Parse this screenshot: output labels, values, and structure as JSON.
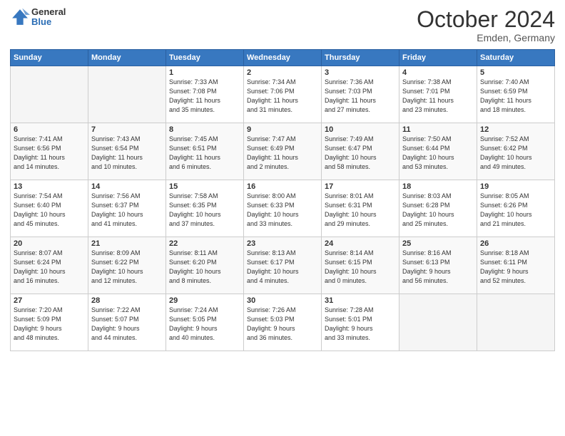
{
  "header": {
    "logo_general": "General",
    "logo_blue": "Blue",
    "month_title": "October 2024",
    "location": "Emden, Germany"
  },
  "weekdays": [
    "Sunday",
    "Monday",
    "Tuesday",
    "Wednesday",
    "Thursday",
    "Friday",
    "Saturday"
  ],
  "weeks": [
    [
      {
        "day": "",
        "info": ""
      },
      {
        "day": "",
        "info": ""
      },
      {
        "day": "1",
        "info": "Sunrise: 7:33 AM\nSunset: 7:08 PM\nDaylight: 11 hours\nand 35 minutes."
      },
      {
        "day": "2",
        "info": "Sunrise: 7:34 AM\nSunset: 7:06 PM\nDaylight: 11 hours\nand 31 minutes."
      },
      {
        "day": "3",
        "info": "Sunrise: 7:36 AM\nSunset: 7:03 PM\nDaylight: 11 hours\nand 27 minutes."
      },
      {
        "day": "4",
        "info": "Sunrise: 7:38 AM\nSunset: 7:01 PM\nDaylight: 11 hours\nand 23 minutes."
      },
      {
        "day": "5",
        "info": "Sunrise: 7:40 AM\nSunset: 6:59 PM\nDaylight: 11 hours\nand 18 minutes."
      }
    ],
    [
      {
        "day": "6",
        "info": "Sunrise: 7:41 AM\nSunset: 6:56 PM\nDaylight: 11 hours\nand 14 minutes."
      },
      {
        "day": "7",
        "info": "Sunrise: 7:43 AM\nSunset: 6:54 PM\nDaylight: 11 hours\nand 10 minutes."
      },
      {
        "day": "8",
        "info": "Sunrise: 7:45 AM\nSunset: 6:51 PM\nDaylight: 11 hours\nand 6 minutes."
      },
      {
        "day": "9",
        "info": "Sunrise: 7:47 AM\nSunset: 6:49 PM\nDaylight: 11 hours\nand 2 minutes."
      },
      {
        "day": "10",
        "info": "Sunrise: 7:49 AM\nSunset: 6:47 PM\nDaylight: 10 hours\nand 58 minutes."
      },
      {
        "day": "11",
        "info": "Sunrise: 7:50 AM\nSunset: 6:44 PM\nDaylight: 10 hours\nand 53 minutes."
      },
      {
        "day": "12",
        "info": "Sunrise: 7:52 AM\nSunset: 6:42 PM\nDaylight: 10 hours\nand 49 minutes."
      }
    ],
    [
      {
        "day": "13",
        "info": "Sunrise: 7:54 AM\nSunset: 6:40 PM\nDaylight: 10 hours\nand 45 minutes."
      },
      {
        "day": "14",
        "info": "Sunrise: 7:56 AM\nSunset: 6:37 PM\nDaylight: 10 hours\nand 41 minutes."
      },
      {
        "day": "15",
        "info": "Sunrise: 7:58 AM\nSunset: 6:35 PM\nDaylight: 10 hours\nand 37 minutes."
      },
      {
        "day": "16",
        "info": "Sunrise: 8:00 AM\nSunset: 6:33 PM\nDaylight: 10 hours\nand 33 minutes."
      },
      {
        "day": "17",
        "info": "Sunrise: 8:01 AM\nSunset: 6:31 PM\nDaylight: 10 hours\nand 29 minutes."
      },
      {
        "day": "18",
        "info": "Sunrise: 8:03 AM\nSunset: 6:28 PM\nDaylight: 10 hours\nand 25 minutes."
      },
      {
        "day": "19",
        "info": "Sunrise: 8:05 AM\nSunset: 6:26 PM\nDaylight: 10 hours\nand 21 minutes."
      }
    ],
    [
      {
        "day": "20",
        "info": "Sunrise: 8:07 AM\nSunset: 6:24 PM\nDaylight: 10 hours\nand 16 minutes."
      },
      {
        "day": "21",
        "info": "Sunrise: 8:09 AM\nSunset: 6:22 PM\nDaylight: 10 hours\nand 12 minutes."
      },
      {
        "day": "22",
        "info": "Sunrise: 8:11 AM\nSunset: 6:20 PM\nDaylight: 10 hours\nand 8 minutes."
      },
      {
        "day": "23",
        "info": "Sunrise: 8:13 AM\nSunset: 6:17 PM\nDaylight: 10 hours\nand 4 minutes."
      },
      {
        "day": "24",
        "info": "Sunrise: 8:14 AM\nSunset: 6:15 PM\nDaylight: 10 hours\nand 0 minutes."
      },
      {
        "day": "25",
        "info": "Sunrise: 8:16 AM\nSunset: 6:13 PM\nDaylight: 9 hours\nand 56 minutes."
      },
      {
        "day": "26",
        "info": "Sunrise: 8:18 AM\nSunset: 6:11 PM\nDaylight: 9 hours\nand 52 minutes."
      }
    ],
    [
      {
        "day": "27",
        "info": "Sunrise: 7:20 AM\nSunset: 5:09 PM\nDaylight: 9 hours\nand 48 minutes."
      },
      {
        "day": "28",
        "info": "Sunrise: 7:22 AM\nSunset: 5:07 PM\nDaylight: 9 hours\nand 44 minutes."
      },
      {
        "day": "29",
        "info": "Sunrise: 7:24 AM\nSunset: 5:05 PM\nDaylight: 9 hours\nand 40 minutes."
      },
      {
        "day": "30",
        "info": "Sunrise: 7:26 AM\nSunset: 5:03 PM\nDaylight: 9 hours\nand 36 minutes."
      },
      {
        "day": "31",
        "info": "Sunrise: 7:28 AM\nSunset: 5:01 PM\nDaylight: 9 hours\nand 33 minutes."
      },
      {
        "day": "",
        "info": ""
      },
      {
        "day": "",
        "info": ""
      }
    ]
  ]
}
